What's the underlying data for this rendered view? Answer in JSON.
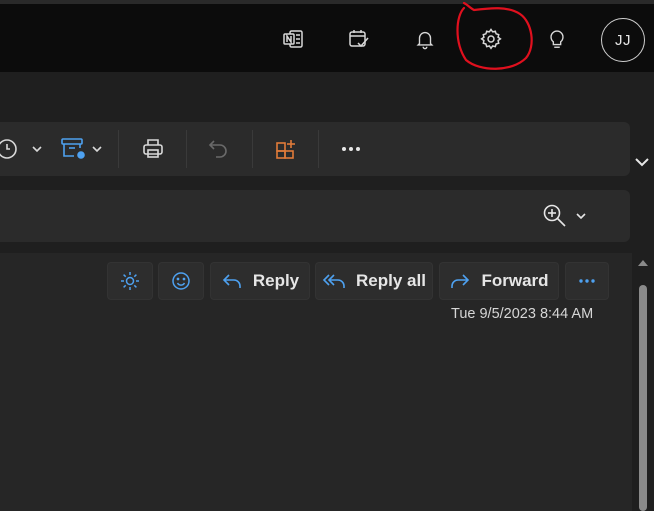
{
  "topbar": {
    "avatar_initials": "JJ",
    "icons": [
      "onenote-icon",
      "calendar-check-icon",
      "bell-icon",
      "gear-icon",
      "lightbulb-icon"
    ],
    "highlight_color": "#e0101e"
  },
  "toolbar": {
    "items": [
      "clock-icon",
      "chevron-down-icon",
      "archive-schedule-icon",
      "chevron-down-icon",
      "print-icon",
      "undo-icon",
      "apps-icon",
      "more-icon"
    ]
  },
  "message": {
    "actions": {
      "reply": "Reply",
      "reply_all": "Reply all",
      "forward": "Forward"
    },
    "timestamp": "Tue 9/5/2023 8:44 AM"
  },
  "colors": {
    "accent_blue": "#4ea1f0",
    "apps_orange": "#e07b39",
    "background": "#1f1f1f",
    "panel": "#2b2b2b"
  }
}
